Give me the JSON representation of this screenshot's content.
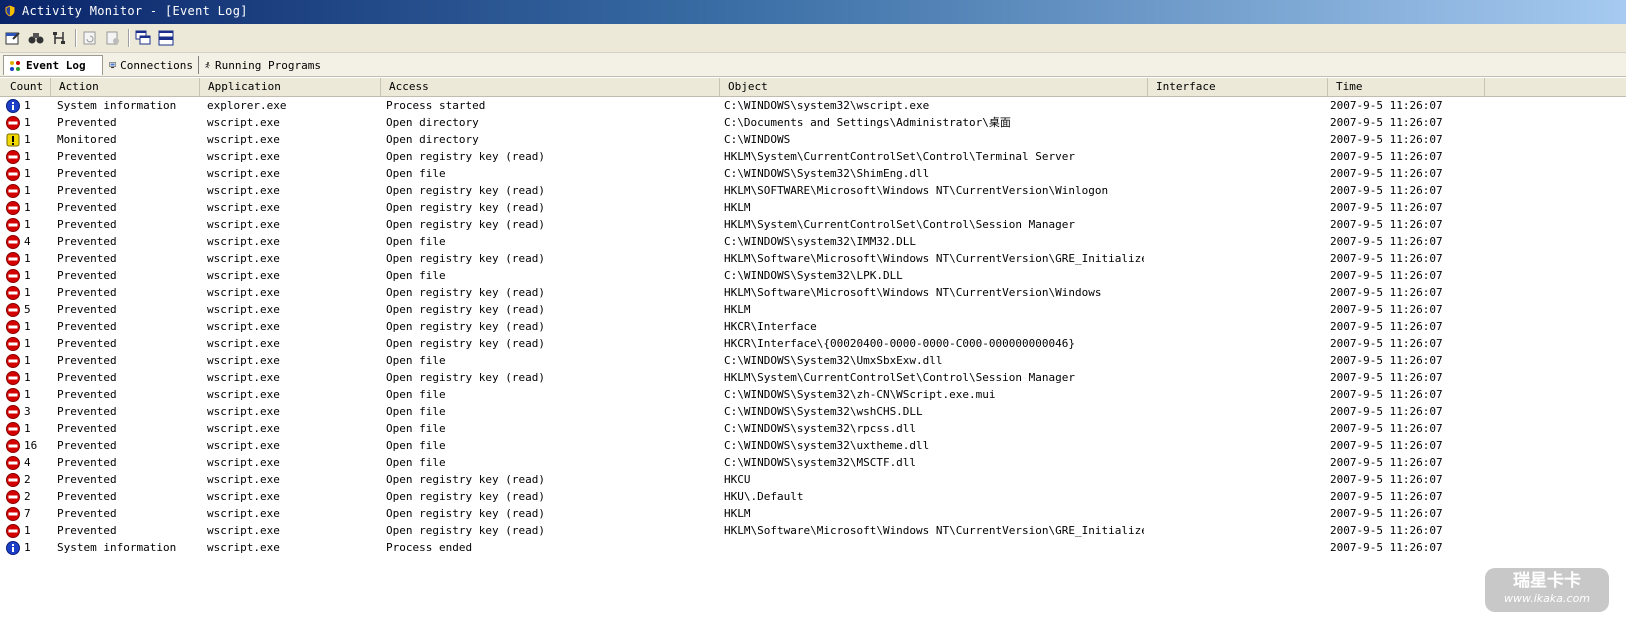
{
  "window": {
    "title": "Activity Monitor - [Event Log]"
  },
  "toolbar": {
    "icons": [
      "properties-icon",
      "find-icon",
      "network-icon",
      "refresh-icon",
      "clear-log-icon",
      "cascade-windows-icon",
      "tile-windows-icon"
    ]
  },
  "tabs": [
    {
      "label": "Event Log",
      "icon": "event-log-icon",
      "active": true
    },
    {
      "label": "Connections",
      "icon": "connections-icon",
      "active": false
    },
    {
      "label": "Running Programs",
      "icon": "running-programs-icon",
      "active": false
    }
  ],
  "columns": [
    "Count",
    "Action",
    "Application",
    "Access",
    "Object",
    "Interface",
    "Time"
  ],
  "rows": [
    {
      "type": "info",
      "count": "1",
      "action": "System information",
      "application": "explorer.exe",
      "access": "Process started",
      "object": "C:\\WINDOWS\\system32\\wscript.exe",
      "interface": "",
      "time": "2007-9-5 11:26:07"
    },
    {
      "type": "prevented",
      "count": "1",
      "action": "Prevented",
      "application": "wscript.exe",
      "access": "Open directory",
      "object": "C:\\Documents and Settings\\Administrator\\桌面",
      "interface": "",
      "time": "2007-9-5 11:26:07"
    },
    {
      "type": "warning",
      "count": "1",
      "action": "Monitored",
      "application": "wscript.exe",
      "access": "Open directory",
      "object": "C:\\WINDOWS",
      "interface": "",
      "time": "2007-9-5 11:26:07"
    },
    {
      "type": "prevented",
      "count": "1",
      "action": "Prevented",
      "application": "wscript.exe",
      "access": "Open registry key (read)",
      "object": "HKLM\\System\\CurrentControlSet\\Control\\Terminal Server",
      "interface": "",
      "time": "2007-9-5 11:26:07"
    },
    {
      "type": "prevented",
      "count": "1",
      "action": "Prevented",
      "application": "wscript.exe",
      "access": "Open file",
      "object": "C:\\WINDOWS\\System32\\ShimEng.dll",
      "interface": "",
      "time": "2007-9-5 11:26:07"
    },
    {
      "type": "prevented",
      "count": "1",
      "action": "Prevented",
      "application": "wscript.exe",
      "access": "Open registry key (read)",
      "object": "HKLM\\SOFTWARE\\Microsoft\\Windows NT\\CurrentVersion\\Winlogon",
      "interface": "",
      "time": "2007-9-5 11:26:07"
    },
    {
      "type": "prevented",
      "count": "1",
      "action": "Prevented",
      "application": "wscript.exe",
      "access": "Open registry key (read)",
      "object": "HKLM",
      "interface": "",
      "time": "2007-9-5 11:26:07"
    },
    {
      "type": "prevented",
      "count": "1",
      "action": "Prevented",
      "application": "wscript.exe",
      "access": "Open registry key (read)",
      "object": "HKLM\\System\\CurrentControlSet\\Control\\Session Manager",
      "interface": "",
      "time": "2007-9-5 11:26:07"
    },
    {
      "type": "prevented",
      "count": "4",
      "action": "Prevented",
      "application": "wscript.exe",
      "access": "Open file",
      "object": "C:\\WINDOWS\\system32\\IMM32.DLL",
      "interface": "",
      "time": "2007-9-5 11:26:07"
    },
    {
      "type": "prevented",
      "count": "1",
      "action": "Prevented",
      "application": "wscript.exe",
      "access": "Open registry key (read)",
      "object": "HKLM\\Software\\Microsoft\\Windows NT\\CurrentVersion\\GRE_Initialize",
      "interface": "",
      "time": "2007-9-5 11:26:07"
    },
    {
      "type": "prevented",
      "count": "1",
      "action": "Prevented",
      "application": "wscript.exe",
      "access": "Open file",
      "object": "C:\\WINDOWS\\System32\\LPK.DLL",
      "interface": "",
      "time": "2007-9-5 11:26:07"
    },
    {
      "type": "prevented",
      "count": "1",
      "action": "Prevented",
      "application": "wscript.exe",
      "access": "Open registry key (read)",
      "object": "HKLM\\Software\\Microsoft\\Windows NT\\CurrentVersion\\Windows",
      "interface": "",
      "time": "2007-9-5 11:26:07"
    },
    {
      "type": "prevented",
      "count": "5",
      "action": "Prevented",
      "application": "wscript.exe",
      "access": "Open registry key (read)",
      "object": "HKLM",
      "interface": "",
      "time": "2007-9-5 11:26:07"
    },
    {
      "type": "prevented",
      "count": "1",
      "action": "Prevented",
      "application": "wscript.exe",
      "access": "Open registry key (read)",
      "object": "HKCR\\Interface",
      "interface": "",
      "time": "2007-9-5 11:26:07"
    },
    {
      "type": "prevented",
      "count": "1",
      "action": "Prevented",
      "application": "wscript.exe",
      "access": "Open registry key (read)",
      "object": "HKCR\\Interface\\{00020400-0000-0000-C000-000000000046}",
      "interface": "",
      "time": "2007-9-5 11:26:07"
    },
    {
      "type": "prevented",
      "count": "1",
      "action": "Prevented",
      "application": "wscript.exe",
      "access": "Open file",
      "object": "C:\\WINDOWS\\System32\\UmxSbxExw.dll",
      "interface": "",
      "time": "2007-9-5 11:26:07"
    },
    {
      "type": "prevented",
      "count": "1",
      "action": "Prevented",
      "application": "wscript.exe",
      "access": "Open registry key (read)",
      "object": "HKLM\\System\\CurrentControlSet\\Control\\Session Manager",
      "interface": "",
      "time": "2007-9-5 11:26:07"
    },
    {
      "type": "prevented",
      "count": "1",
      "action": "Prevented",
      "application": "wscript.exe",
      "access": "Open file",
      "object": "C:\\WINDOWS\\System32\\zh-CN\\WScript.exe.mui",
      "interface": "",
      "time": "2007-9-5 11:26:07"
    },
    {
      "type": "prevented",
      "count": "3",
      "action": "Prevented",
      "application": "wscript.exe",
      "access": "Open file",
      "object": "C:\\WINDOWS\\System32\\wshCHS.DLL",
      "interface": "",
      "time": "2007-9-5 11:26:07"
    },
    {
      "type": "prevented",
      "count": "1",
      "action": "Prevented",
      "application": "wscript.exe",
      "access": "Open file",
      "object": "C:\\WINDOWS\\system32\\rpcss.dll",
      "interface": "",
      "time": "2007-9-5 11:26:07"
    },
    {
      "type": "prevented",
      "count": "16",
      "action": "Prevented",
      "application": "wscript.exe",
      "access": "Open file",
      "object": "C:\\WINDOWS\\system32\\uxtheme.dll",
      "interface": "",
      "time": "2007-9-5 11:26:07"
    },
    {
      "type": "prevented",
      "count": "4",
      "action": "Prevented",
      "application": "wscript.exe",
      "access": "Open file",
      "object": "C:\\WINDOWS\\system32\\MSCTF.dll",
      "interface": "",
      "time": "2007-9-5 11:26:07"
    },
    {
      "type": "prevented",
      "count": "2",
      "action": "Prevented",
      "application": "wscript.exe",
      "access": "Open registry key (read)",
      "object": "HKCU",
      "interface": "",
      "time": "2007-9-5 11:26:07"
    },
    {
      "type": "prevented",
      "count": "2",
      "action": "Prevented",
      "application": "wscript.exe",
      "access": "Open registry key (read)",
      "object": "HKU\\.Default",
      "interface": "",
      "time": "2007-9-5 11:26:07"
    },
    {
      "type": "prevented",
      "count": "7",
      "action": "Prevented",
      "application": "wscript.exe",
      "access": "Open registry key (read)",
      "object": "HKLM",
      "interface": "",
      "time": "2007-9-5 11:26:07"
    },
    {
      "type": "prevented",
      "count": "1",
      "action": "Prevented",
      "application": "wscript.exe",
      "access": "Open registry key (read)",
      "object": "HKLM\\Software\\Microsoft\\Windows NT\\CurrentVersion\\GRE_Initialize",
      "interface": "",
      "time": "2007-9-5 11:26:07"
    },
    {
      "type": "info",
      "count": "1",
      "action": "System information",
      "application": "wscript.exe",
      "access": "Process ended",
      "object": "",
      "interface": "",
      "time": "2007-9-5 11:26:07"
    }
  ],
  "watermark": {
    "main": "瑞星卡卡",
    "sub": "www.ikaka.com"
  },
  "colors": {
    "titlebar_start": "#0a246a",
    "titlebar_end": "#a6caf0",
    "prevented": "#d40000",
    "info": "#1c3fc8",
    "warning": "#f0d800"
  }
}
